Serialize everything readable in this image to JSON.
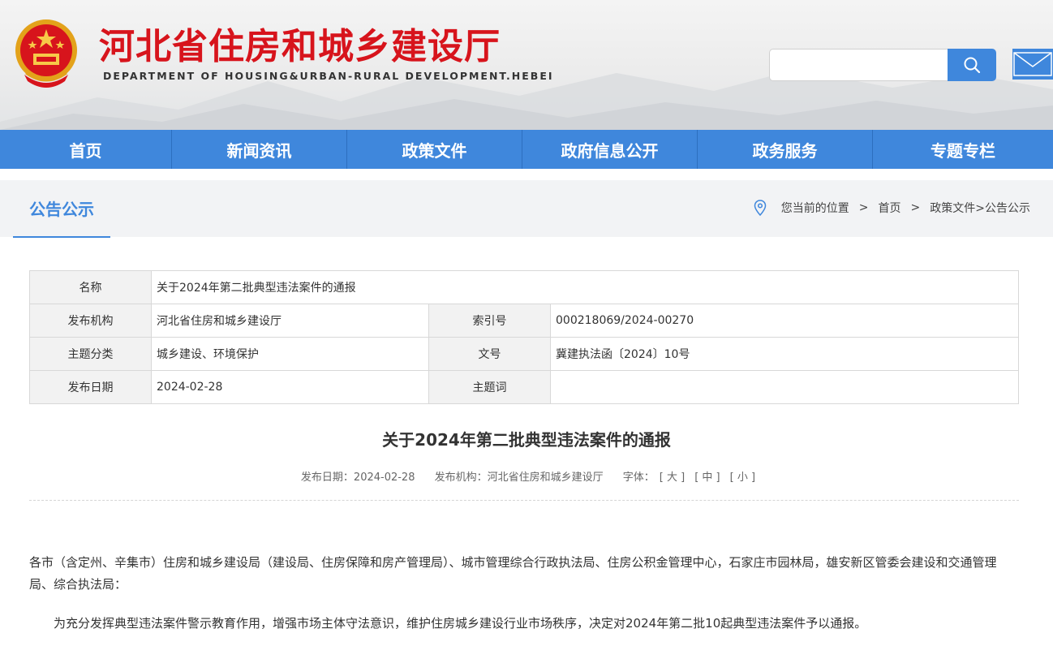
{
  "header": {
    "title": "河北省住房和城乡建设厅",
    "subtitle": "DEPARTMENT OF HOUSING&URBAN-RURAL DEVELOPMENT.HEBEI",
    "search_placeholder": "",
    "search_icon": "search-icon",
    "mail_icon": "mail-icon",
    "emblem_icon": "national-emblem-icon"
  },
  "nav": {
    "items": [
      "首页",
      "新闻资讯",
      "政策文件",
      "政府信息公开",
      "政务服务",
      "专题专栏"
    ]
  },
  "section": {
    "tab_label": "公告公示",
    "location_label": "您当前的位置",
    "crumb_home": "首页",
    "crumb_path": "政策文件>公告公示"
  },
  "info": {
    "name_label": "名称",
    "name_value": "关于2024年第二批典型违法案件的通报",
    "org_label": "发布机构",
    "org_value": "河北省住房和城乡建设厅",
    "index_label": "索引号",
    "index_value": "000218069/2024-00270",
    "topic_label": "主题分类",
    "topic_value": "城乡建设、环境保护",
    "doc_label": "文号",
    "doc_value": "冀建执法函〔2024〕10号",
    "date_label": "发布日期",
    "date_value": "2024-02-28",
    "keyword_label": "主题词",
    "keyword_value": ""
  },
  "article": {
    "title": "关于2024年第二批典型违法案件的通报",
    "meta_date": "发布日期：2024-02-28",
    "meta_org": "发布机构：河北省住房和城乡建设厅",
    "font_label": "字体：",
    "font_large": "[ 大 ]",
    "font_medium": "[ 中 ]",
    "font_small": "[ 小 ]",
    "para1": "各市（含定州、辛集市）住房和城乡建设局（建设局、住房保障和房产管理局）、城市管理综合行政执法局、住房公积金管理中心，石家庄市园林局，雄安新区管委会建设和交通管理局、综合执法局：",
    "para2": "为充分发挥典型违法案件警示教育作用，增强市场主体守法意识，维护住房城乡建设行业市场秩序，决定对2024年第二批10起典型违法案件予以通报。"
  },
  "colors": {
    "brand_red": "#d7141c",
    "accent_blue": "#3f87dc"
  }
}
